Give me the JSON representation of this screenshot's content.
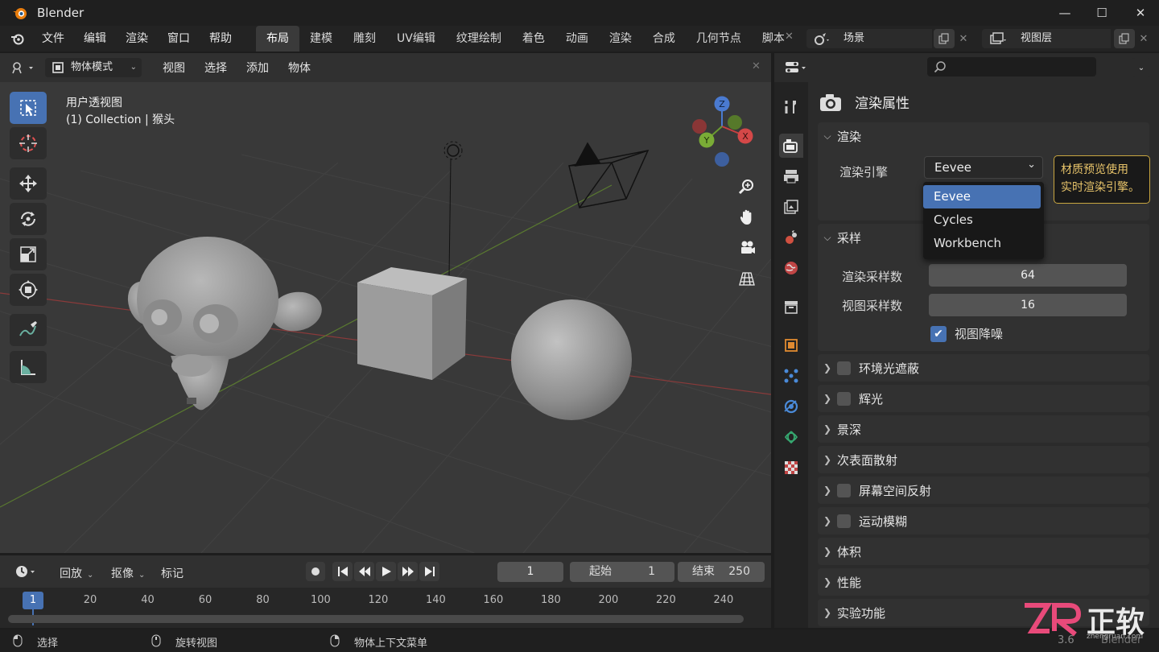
{
  "app": {
    "title": "Blender",
    "version": "3.6"
  },
  "menu": {
    "items": [
      "文件",
      "编辑",
      "渲染",
      "窗口",
      "帮助"
    ]
  },
  "workspaces": {
    "tabs": [
      "布局",
      "建模",
      "雕刻",
      "UV编辑",
      "纹理绘制",
      "着色",
      "动画",
      "渲染",
      "合成",
      "几何节点",
      "脚本"
    ],
    "active": "布局"
  },
  "scene": {
    "name": "场景"
  },
  "view_layer": {
    "name": "视图层"
  },
  "viewport": {
    "mode": "物体模式",
    "menus": [
      "视图",
      "选择",
      "添加",
      "物体"
    ],
    "overlay_title": "用户透视图",
    "overlay_sub": "(1) Collection | 猴头",
    "gizmo": {
      "z": "Z",
      "y": "Y",
      "x": "X"
    }
  },
  "timeline": {
    "menus": [
      "回放",
      "抠像",
      "标记"
    ],
    "current_frame": "1",
    "start_label": "起始",
    "start_value": "1",
    "end_label": "结束",
    "end_value": "250",
    "ticks": [
      "20",
      "40",
      "60",
      "80",
      "100",
      "120",
      "140",
      "160",
      "180",
      "200",
      "220",
      "240"
    ],
    "playhead": "1"
  },
  "status": {
    "select": "选择",
    "rotate": "旋转视图",
    "context": "物体上下文菜单"
  },
  "properties": {
    "title": "渲染属性",
    "render_section": "渲染",
    "engine_label": "渲染引擎",
    "engine_value": "Eevee",
    "engine_options": [
      "Eevee",
      "Cycles",
      "Workbench"
    ],
    "tooltip_line1": "材质预览使用",
    "tooltip_line2": "实时渲染引擎。",
    "sampling_section": "采样",
    "render_samples_label": "渲染采样数",
    "render_samples": "64",
    "viewport_samples_label": "视图采样数",
    "viewport_samples": "16",
    "denoise_label": "视图降噪",
    "sections": [
      "环境光遮蔽",
      "辉光",
      "景深",
      "次表面散射",
      "屏幕空间反射",
      "运动模糊",
      "体积",
      "性能",
      "实验功能"
    ]
  },
  "watermark": {
    "text": "正软",
    "sub": "zhengruan.com"
  },
  "colors": {
    "accent": "#4772b3",
    "tooltip": "#e8c46a"
  }
}
